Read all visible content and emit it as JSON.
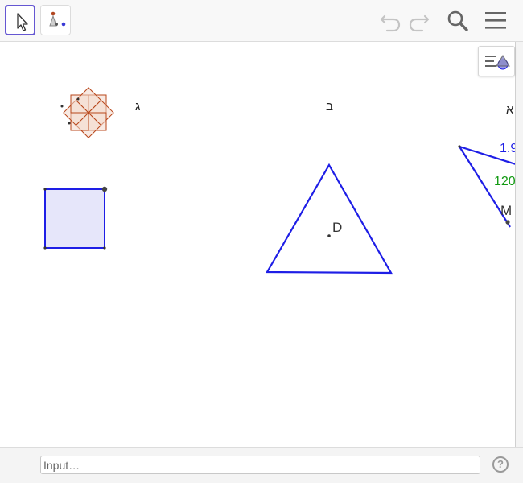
{
  "toolbar": {
    "tools": [
      {
        "name": "move-tool",
        "icon": "arrow-cursor-icon",
        "selected": true
      },
      {
        "name": "point-tool",
        "icon": "points-icon",
        "selected": false
      }
    ],
    "actions": [
      {
        "name": "undo",
        "icon": "undo-icon"
      },
      {
        "name": "redo",
        "icon": "redo-icon"
      },
      {
        "name": "search",
        "icon": "search-icon"
      },
      {
        "name": "menu",
        "icon": "hamburger-menu-icon"
      }
    ]
  },
  "graphics": {
    "style_bar_icon": "graphics-style-bar-icon",
    "labels": {
      "label_gimel": "ג",
      "label_bet": "ב",
      "label_alef": "א",
      "point_D": "D",
      "value_blue": "1.9",
      "value_green": "120",
      "point_M": "M"
    },
    "colors": {
      "polygon_stroke": "#1e1ee6",
      "square_fill": "#e6e6fa",
      "flower_stroke": "#b8461a",
      "flower_fill": "#f3d9cc",
      "value_green": "#139a13"
    }
  },
  "input_bar": {
    "placeholder": "Input…",
    "help_label": "?"
  }
}
